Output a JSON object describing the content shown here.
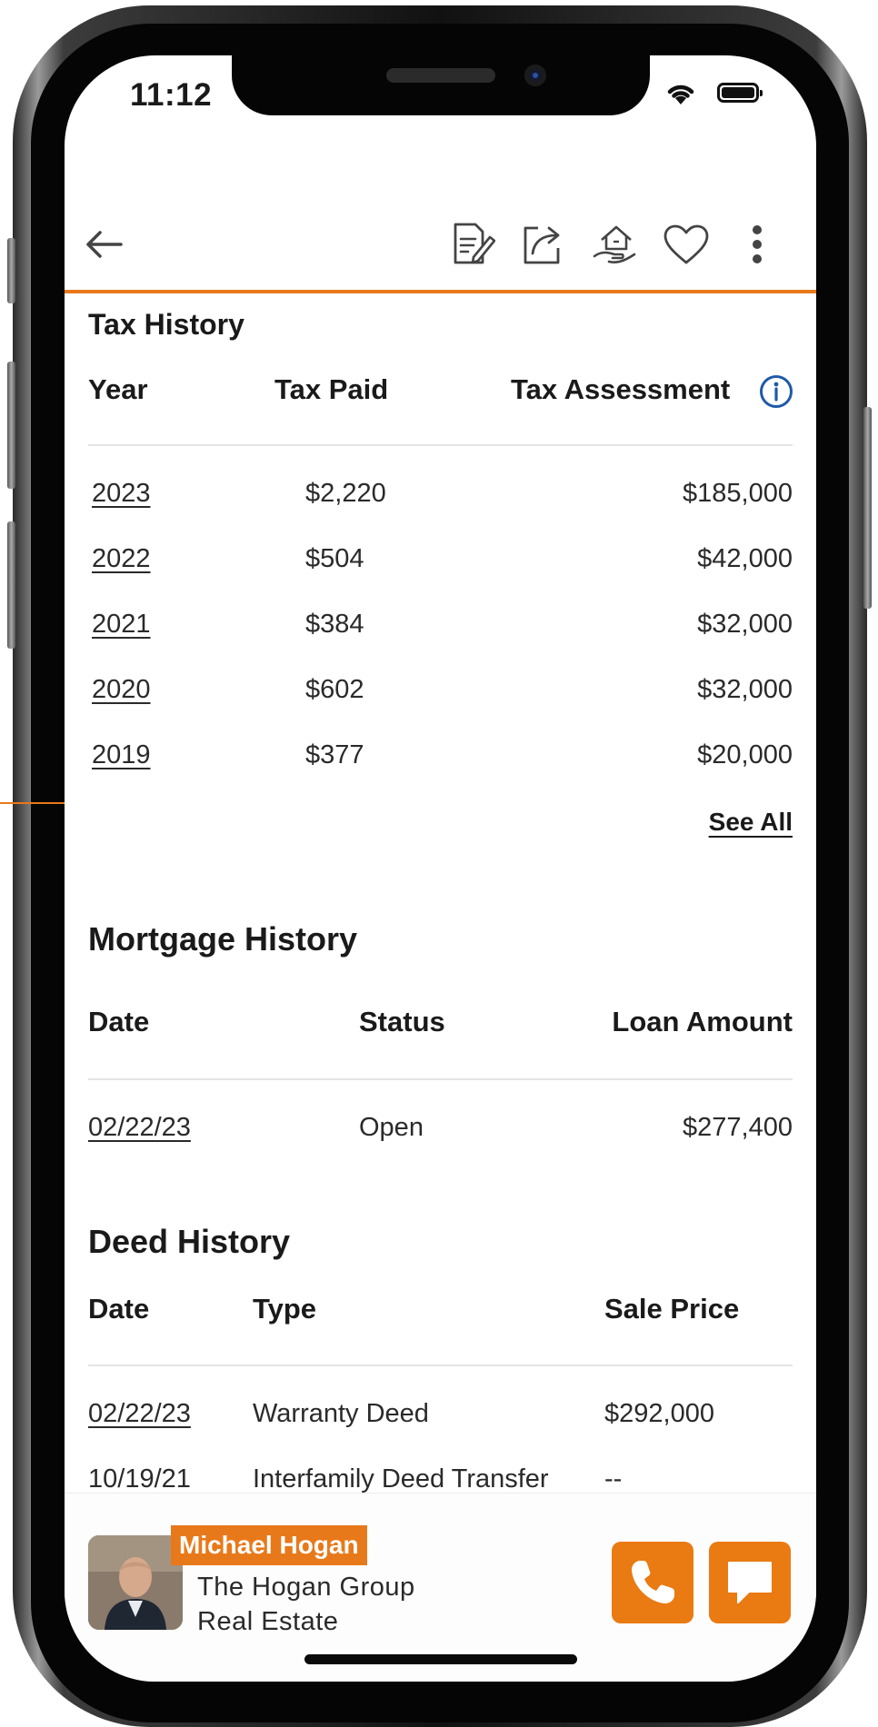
{
  "status_bar": {
    "time": "11:12"
  },
  "tax_history": {
    "title": "Tax History",
    "headers": {
      "year": "Year",
      "tax_paid": "Tax Paid",
      "tax_assessment": "Tax Assessment"
    },
    "rows": [
      {
        "year": "2023",
        "tax_paid": "$2,220",
        "assessment": "$185,000"
      },
      {
        "year": "2022",
        "tax_paid": "$504",
        "assessment": "$42,000"
      },
      {
        "year": "2021",
        "tax_paid": "$384",
        "assessment": "$32,000"
      },
      {
        "year": "2020",
        "tax_paid": "$602",
        "assessment": "$32,000"
      },
      {
        "year": "2019",
        "tax_paid": "$377",
        "assessment": "$20,000"
      }
    ],
    "see_all": "See All"
  },
  "mortgage_history": {
    "title": "Mortgage History",
    "headers": {
      "date": "Date",
      "status": "Status",
      "loan_amount": "Loan Amount"
    },
    "rows": [
      {
        "date": "02/22/23",
        "status": "Open",
        "loan_amount": "$277,400"
      }
    ]
  },
  "deed_history": {
    "title": "Deed History",
    "headers": {
      "date": "Date",
      "type": "Type",
      "sale_price": "Sale Price"
    },
    "rows": [
      {
        "date": "02/22/23",
        "type": "Warranty Deed",
        "sale_price": "$292,000"
      },
      {
        "date": "10/19/21",
        "type": "Interfamily Deed Transfer",
        "sale_price": "--"
      }
    ]
  },
  "agent": {
    "name": "Michael Hogan",
    "company_line1": "The Hogan Group",
    "company_line2": "Real Estate"
  },
  "icons": {
    "back": "back-arrow-icon",
    "notes": "notes-icon",
    "share": "share-icon",
    "home_offer": "home-hand-icon",
    "favorite": "heart-icon",
    "more": "more-vertical-icon",
    "info": "info-icon",
    "call": "phone-icon",
    "message": "chat-icon"
  },
  "colors": {
    "accent": "#e8791a",
    "info_blue": "#1f5aa8",
    "text": "#1a1a1a"
  }
}
